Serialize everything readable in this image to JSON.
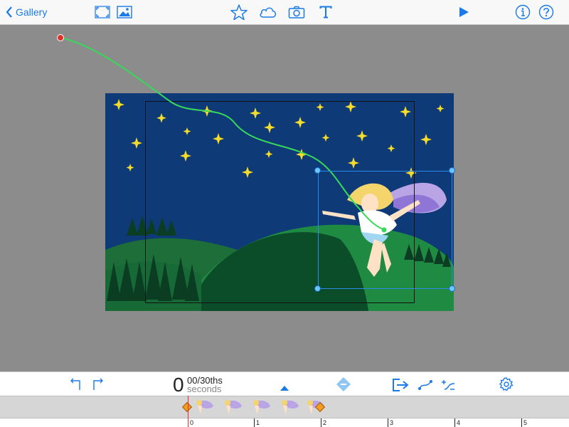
{
  "toolbar": {
    "gallery_label": "Gallery",
    "icons": [
      "fullscreen-icon",
      "image-icon",
      "star-icon",
      "cloud-icon",
      "camera-icon",
      "text-icon",
      "play-icon",
      "info-icon",
      "help-icon"
    ],
    "accent": "#1a7ae8"
  },
  "timecode": {
    "seconds": "0",
    "fraction": "00/30ths",
    "unit": "seconds"
  },
  "bottom_toolbar": {
    "icons": [
      "undo-icon",
      "redo-icon",
      "expand-up-icon",
      "keyframe-diamond-icon",
      "export-icon",
      "motion-path-icon",
      "add-easing-icon",
      "settings-gear-icon"
    ]
  },
  "timeline": {
    "ruler_labels": [
      "0",
      "1",
      "2",
      "3",
      "4",
      "5"
    ],
    "playhead_color": "#e03030",
    "keyframe_color": "#f39c25"
  },
  "scene": {
    "sky_color": "#0e3a77",
    "hill_color": "#1f7a3c",
    "path_color": "#38d85a"
  }
}
